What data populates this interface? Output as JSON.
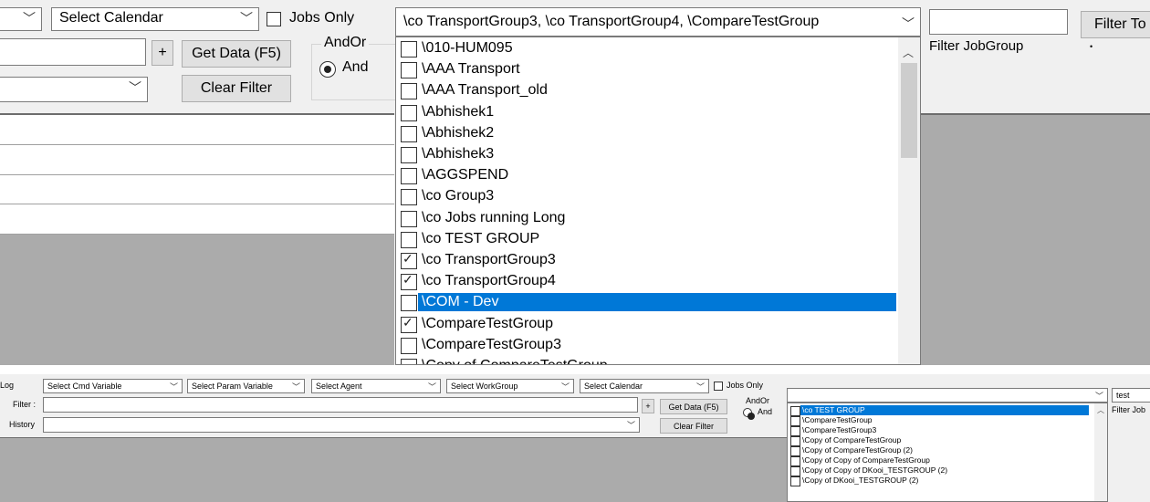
{
  "top": {
    "calendar_select": "Select Calendar",
    "jobs_only_label": "Jobs Only",
    "jobgroup_combo_value": "\\co TransportGroup3, \\co TransportGroup4, \\CompareTestGroup",
    "plus_label": "+",
    "get_data_label": "Get Data (F5)",
    "clear_filter_label": "Clear Filter",
    "andor_label": "AndOr",
    "and_label": "And",
    "filter_jobgroup_label": "Filter JobGroup",
    "filter_to_label": "Filter To",
    "dot": "•",
    "list_items": [
      {
        "label": "\\010-HUM095",
        "checked": false,
        "selected": false
      },
      {
        "label": "\\AAA Transport",
        "checked": false,
        "selected": false
      },
      {
        "label": "\\AAA Transport_old",
        "checked": false,
        "selected": false
      },
      {
        "label": "\\Abhishek1",
        "checked": false,
        "selected": false
      },
      {
        "label": "\\Abhishek2",
        "checked": false,
        "selected": false
      },
      {
        "label": "\\Abhishek3",
        "checked": false,
        "selected": false
      },
      {
        "label": "\\AGGSPEND",
        "checked": false,
        "selected": false
      },
      {
        "label": "\\co Group3",
        "checked": false,
        "selected": false
      },
      {
        "label": "\\co Jobs running Long",
        "checked": false,
        "selected": false
      },
      {
        "label": "\\co TEST GROUP",
        "checked": false,
        "selected": false
      },
      {
        "label": "\\co TransportGroup3",
        "checked": true,
        "selected": false
      },
      {
        "label": "\\co TransportGroup4",
        "checked": true,
        "selected": false
      },
      {
        "label": "\\COM - Dev",
        "checked": false,
        "selected": true
      },
      {
        "label": "\\CompareTestGroup",
        "checked": true,
        "selected": false
      },
      {
        "label": "\\CompareTestGroup3",
        "checked": false,
        "selected": false
      },
      {
        "label": "\\Copy of CompareTestGroup",
        "checked": false,
        "selected": false
      }
    ]
  },
  "bottom": {
    "log_label": "Log",
    "cmd_variable": "Select Cmd Variable",
    "param_variable": "Select Param Variable",
    "agent": "Select Agent",
    "workgroup": "Select WorkGroup",
    "calendar": "Select Calendar",
    "jobs_only_label": "Jobs Only",
    "filter_label": "Filter :",
    "history_label": "History",
    "plus_label": "+",
    "get_data_label": "Get Data (F5)",
    "clear_filter_label": "Clear Filter",
    "andor_label": "AndOr",
    "and_label": "And",
    "jobgroup_combo_value": "",
    "search_value": "test",
    "filter_jobgroup_label": "Filter Job",
    "list_items": [
      {
        "label": "\\co TEST GROUP",
        "checked": false,
        "selected": true
      },
      {
        "label": "\\CompareTestGroup",
        "checked": false,
        "selected": false
      },
      {
        "label": "\\CompareTestGroup3",
        "checked": false,
        "selected": false
      },
      {
        "label": "\\Copy of CompareTestGroup",
        "checked": false,
        "selected": false
      },
      {
        "label": "\\Copy of CompareTestGroup (2)",
        "checked": false,
        "selected": false
      },
      {
        "label": "\\Copy of Copy of CompareTestGroup",
        "checked": false,
        "selected": false
      },
      {
        "label": "\\Copy of Copy of DKooi_TESTGROUP (2)",
        "checked": false,
        "selected": false
      },
      {
        "label": "\\Copy of DKooi_TESTGROUP (2)",
        "checked": false,
        "selected": false
      }
    ]
  },
  "colors": {
    "selection": "#0078d7",
    "window_bg": "#f0f0f0",
    "grid_gray": "#a0a0a0"
  }
}
